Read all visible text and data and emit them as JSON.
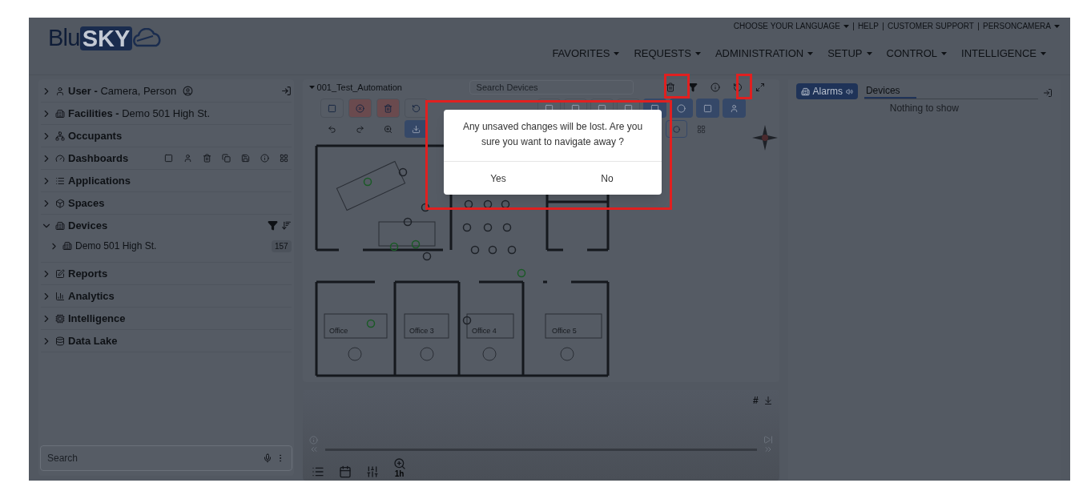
{
  "brand": {
    "prefix": "Blu",
    "highlight": "SKY"
  },
  "top_links": [
    {
      "label": "CHOOSE YOUR LANGUAGE",
      "dropdown": true
    },
    {
      "label": "HELP",
      "dropdown": false
    },
    {
      "label": "CUSTOMER SUPPORT",
      "dropdown": false
    },
    {
      "label": "PERSONCAMERA",
      "dropdown": true
    }
  ],
  "nav": [
    "FAVORITES",
    "REQUESTS",
    "ADMINISTRATION",
    "SETUP",
    "CONTROL",
    "INTELLIGENCE"
  ],
  "sidebar": {
    "items": [
      {
        "label": "User -",
        "detail": "Camera, Person",
        "expanded": false,
        "kind": "user"
      },
      {
        "label": "Facilities -",
        "detail": "Demo 501 High St.",
        "expanded": false,
        "kind": "plain"
      },
      {
        "label": "Occupants",
        "expanded": false,
        "kind": "plain"
      },
      {
        "label": "Dashboards",
        "expanded": false,
        "kind": "tools"
      },
      {
        "label": "Applications",
        "expanded": false,
        "kind": "plain"
      },
      {
        "label": "Spaces",
        "expanded": false,
        "kind": "plain"
      },
      {
        "label": "Devices",
        "expanded": true,
        "kind": "filter",
        "children": [
          {
            "label": "Demo 501 High St.",
            "badge": "157"
          }
        ]
      },
      {
        "label": "Reports",
        "expanded": false,
        "kind": "plain"
      },
      {
        "label": "Analytics",
        "expanded": false,
        "kind": "plain"
      },
      {
        "label": "Intelligence",
        "expanded": false,
        "kind": "plain"
      },
      {
        "label": "Data Lake",
        "expanded": false,
        "kind": "plain"
      }
    ],
    "search": {
      "placeholder": "Search"
    }
  },
  "map": {
    "title": "001_Test_Automation",
    "search": {
      "placeholder": "Search Devices"
    },
    "rooms": [
      {
        "label": "Office"
      },
      {
        "label": "Office 3"
      },
      {
        "label": "Office 4"
      },
      {
        "label": "Office 5"
      }
    ]
  },
  "timeline": {
    "hash": "#",
    "zoom_label": "1h"
  },
  "right_panel": {
    "alarms_button": "Alarms",
    "tabs": [
      {
        "label": "Devices",
        "selected": true
      }
    ],
    "empty": "Nothing to show"
  },
  "dialog": {
    "message": "Any unsaved changes will be lost. Are you sure you want to navigate away ?",
    "buttons": [
      "Yes",
      "No"
    ]
  }
}
